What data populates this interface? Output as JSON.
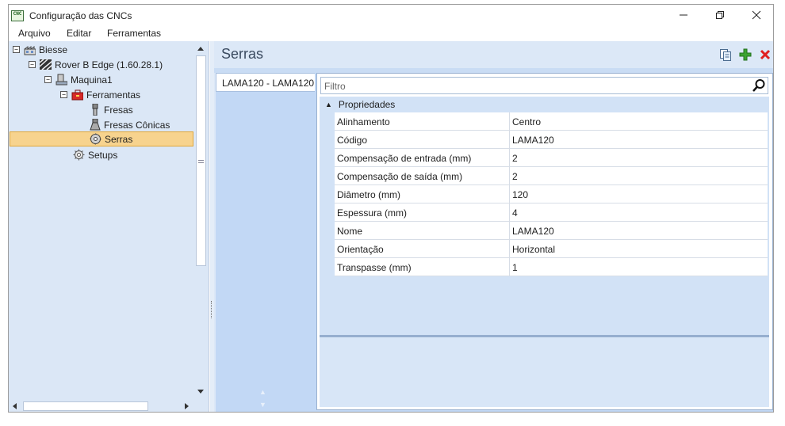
{
  "window": {
    "title": "Configuração das CNCs",
    "app_icon_text": "CNC",
    "minimize_icon": "minimize-icon",
    "maximize_icon": "restore-icon",
    "close_icon": "close-icon"
  },
  "menubar": {
    "items": [
      "Arquivo",
      "Editar",
      "Ferramentas"
    ]
  },
  "tree": {
    "nodes": [
      {
        "label": "Biesse",
        "icon": "factory-icon",
        "expander": "−",
        "level": 0
      },
      {
        "label": "Rover B Edge (1.60.28.1)",
        "icon": "machine-stripes-icon",
        "expander": "−",
        "level": 1
      },
      {
        "label": "Maquina1",
        "icon": "cnc-machine-icon",
        "expander": "−",
        "level": 2
      },
      {
        "label": "Ferramentas",
        "icon": "toolbox-icon",
        "expander": "−",
        "level": 3
      },
      {
        "label": "Fresas",
        "icon": "mill-tool-icon",
        "level": 4
      },
      {
        "label": "Fresas Cônicas",
        "icon": "conical-mill-icon",
        "level": 4
      },
      {
        "label": "Serras",
        "icon": "saw-blade-icon",
        "level": 4,
        "selected": true
      },
      {
        "label": "Setups",
        "icon": "gear-icon",
        "level": 3
      }
    ]
  },
  "main": {
    "section_title": "Serras",
    "toolbar": {
      "copy_icon": "copy-icon",
      "add_icon": "add-icon",
      "delete_icon": "delete-icon"
    },
    "list_items": [
      "LAMA120 - LAMA120"
    ],
    "filter": {
      "placeholder": "Filtro",
      "value": ""
    },
    "group": {
      "label": "Propriedades"
    },
    "properties": [
      {
        "name": "Alinhamento",
        "value": "Centro"
      },
      {
        "name": "Código",
        "value": "LAMA120"
      },
      {
        "name": "Compensação de entrada (mm)",
        "value": "2"
      },
      {
        "name": "Compensação de saída (mm)",
        "value": "2"
      },
      {
        "name": "Diâmetro (mm)",
        "value": "120"
      },
      {
        "name": "Espessura (mm)",
        "value": "4"
      },
      {
        "name": "Nome",
        "value": "LAMA120"
      },
      {
        "name": "Orientação",
        "value": "Horizontal"
      },
      {
        "name": "Transpasse (mm)",
        "value": "1"
      }
    ]
  },
  "colors": {
    "selection_bg": "#f7d38e",
    "panel_bg": "#dce8f7",
    "add_green": "#3ca331",
    "delete_red": "#e02020"
  }
}
